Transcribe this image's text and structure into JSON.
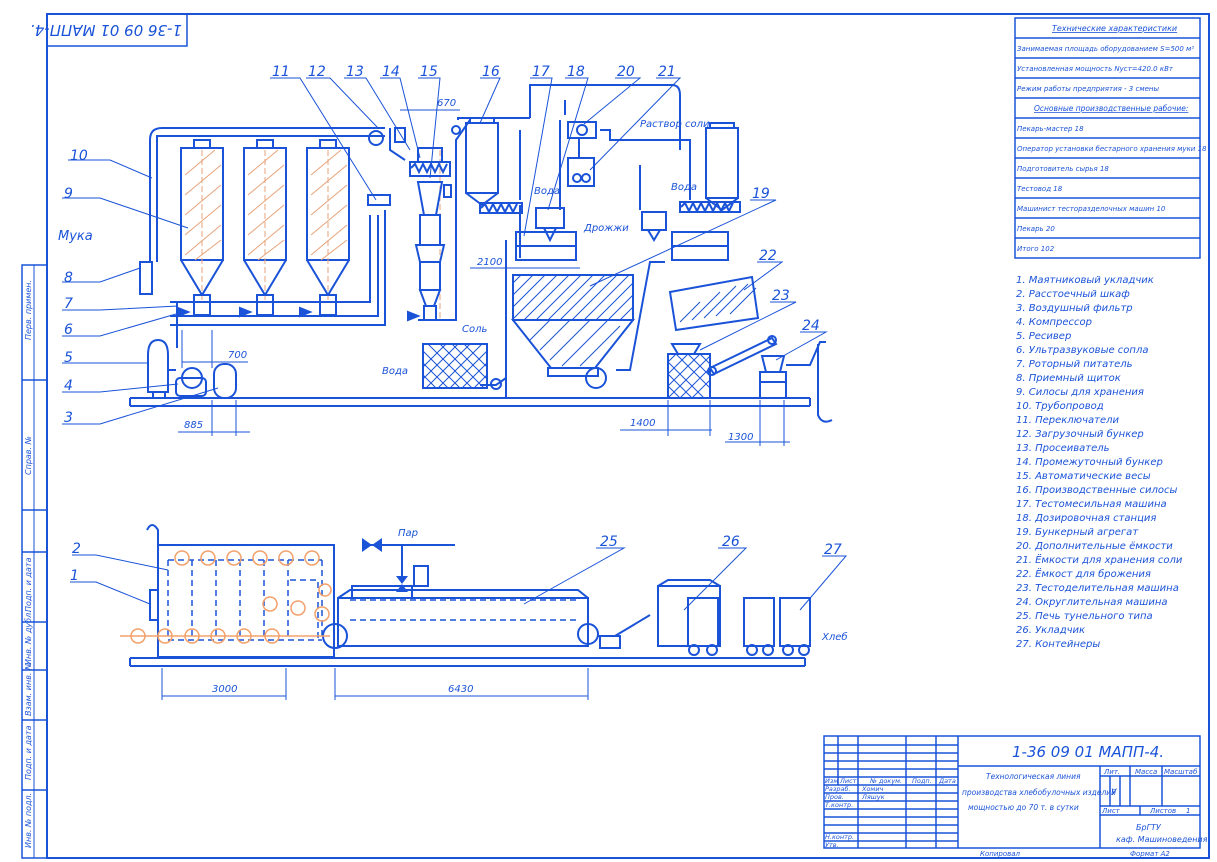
{
  "stamp_code_rotated": "1-36 09 01 МАПП-4.",
  "dims": {
    "d700": "700",
    "d885": "885",
    "d670": "670",
    "d2100": "2100",
    "d1400": "1400",
    "d1300": "1300",
    "d3000": "3000",
    "d6430": "6430"
  },
  "inline_labels": {
    "muka": "Мука",
    "voda1": "Вода",
    "voda2": "Вода",
    "voda3": "Вода",
    "rastvor_soli": "Раствор соли",
    "drozhzhi": "Дрожжи",
    "sol": "Соль",
    "par": "Пар",
    "hleb": "Хлеб"
  },
  "leaders": [
    "1",
    "2",
    "3",
    "4",
    "5",
    "6",
    "7",
    "8",
    "9",
    "10",
    "11",
    "12",
    "13",
    "14",
    "15",
    "16",
    "17",
    "18",
    "19",
    "20",
    "21",
    "22",
    "23",
    "24",
    "25",
    "26",
    "27"
  ],
  "tech": {
    "title": "Технические характеристики",
    "rows": [
      "Занимаемая площадь оборудованием S=500 м²",
      "Установленная мощность Nуст=420.0 кВт",
      "Режим работы предприятия - 3 смены"
    ],
    "workers_title": "Основные производственные рабочие:",
    "workers": [
      "Пекарь-мастер 18",
      "Оператор установки бестарного хранения муки 18",
      "Подготовитель сырья 18",
      "Тестовод 18",
      "Машинист тесторазделочных машин 10",
      "Пекарь 20",
      "Итого 102"
    ]
  },
  "legend": [
    "1. Маятниковый укладчик",
    "2. Расстоечный шкаф",
    "3. Воздушный фильтр",
    "4. Компрессор",
    "5. Ресивер",
    "6. Ультразвуковые сопла",
    "7. Роторный питатель",
    "8. Приемный щиток",
    "9. Силосы для хранения",
    "10. Трубопровод",
    "11. Переключатели",
    "12. Загрузочный бункер",
    "13. Просеиватель",
    "14. Промежуточный бункер",
    "15. Автоматические весы",
    "16. Производственные силосы",
    "17. Тестомесильная машина",
    "18. Дозировочная станция",
    "19. Бункерный агрегат",
    "20. Дополнительные ёмкости",
    "21. Ёмкости для хранения соли",
    "22. Ёмкост для брожения",
    "23. Тестоделительная машина",
    "24. Округлительная машина",
    "25. Печь тунельного типа",
    "26. Укладчик",
    "27. Контейнеры"
  ],
  "side_labels": [
    "Перв. примен.",
    "Справ. №",
    "Подп. и дата",
    "Инв. № дубл.",
    "Взам. инв. №",
    "Подп. и дата",
    "Инв. № подл."
  ],
  "title_block": {
    "code": "1-36 09 01 МАПП-4.",
    "name": "Технологическая линия производства хлебобулочных изделий мощностью до 70 т. в сутки",
    "org1": "БрГТУ",
    "org2": "каф. Машиноведения",
    "col_izm": "Изм",
    "col_list": "Лист",
    "col_doc": "№ докум.",
    "col_podp": "Подп.",
    "col_data": "Дата",
    "role_razrab": "Разраб.",
    "person_razrab": "Хомич",
    "role_prov": "Пров.",
    "person_prov": "Ляшук",
    "role_tkontr": "Т.контр.",
    "role_nkontr": "Н.контр.",
    "role_utv": "Утв.",
    "lit": "Лит.",
    "massa": "Масса",
    "masshtab": "Масштаб",
    "lit_value": "У",
    "sheet_label": "Лист",
    "sheets_label": "Листов",
    "sheets_value": "1",
    "copied": "Копировал",
    "format": "Формат A2"
  }
}
